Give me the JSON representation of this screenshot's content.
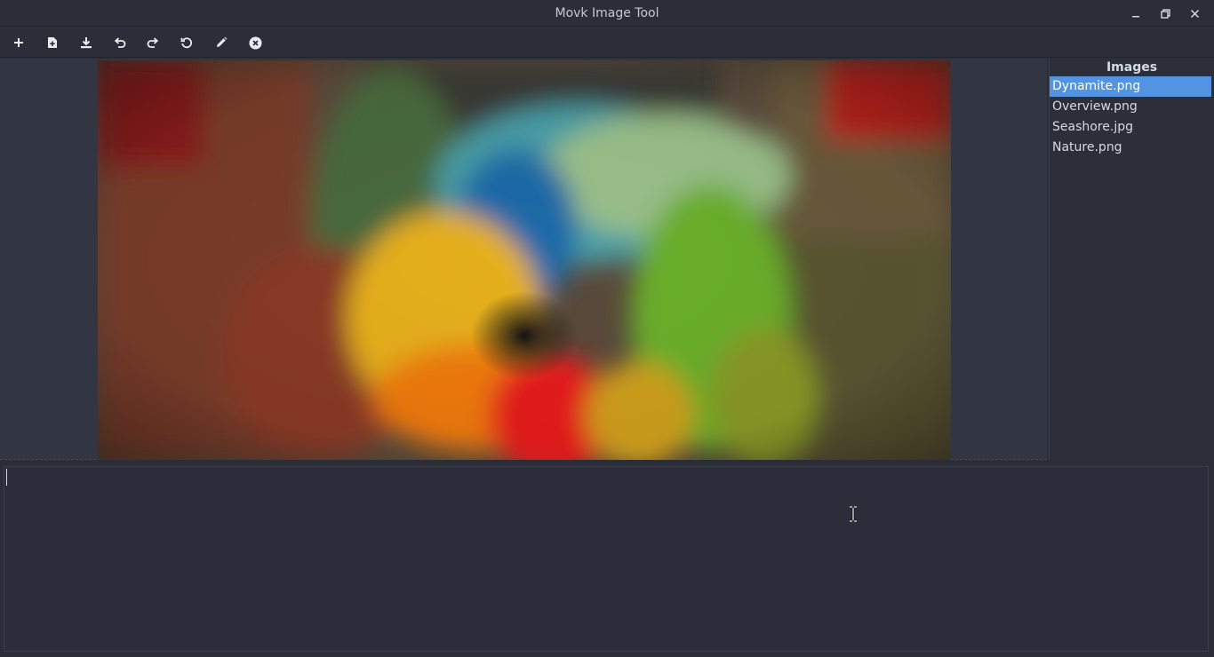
{
  "window": {
    "title": "Movk Image Tool",
    "controls": [
      "minimize-icon",
      "restore-icon",
      "close-icon"
    ]
  },
  "toolbar": {
    "tools": [
      {
        "name": "new",
        "icon": "plus-icon"
      },
      {
        "name": "open-file",
        "icon": "file-plus-icon"
      },
      {
        "name": "download",
        "icon": "download-icon"
      },
      {
        "name": "undo",
        "icon": "undo-icon"
      },
      {
        "name": "redo",
        "icon": "redo-icon"
      },
      {
        "name": "reset",
        "icon": "rotate-ccw-icon"
      },
      {
        "name": "edit",
        "icon": "pencil-icon"
      },
      {
        "name": "close-image",
        "icon": "circle-x-icon"
      }
    ]
  },
  "images_panel": {
    "header": "Images",
    "items": [
      {
        "label": "Dynamite.png",
        "selected": true
      },
      {
        "label": "Overview.png",
        "selected": false
      },
      {
        "label": "Seashore.jpg",
        "selected": false
      },
      {
        "label": "Nature.png",
        "selected": false
      }
    ]
  },
  "editor": {
    "value": ""
  },
  "colors": {
    "accent": "#5294e2",
    "background": "#2b2e39",
    "text": "#d3dae3"
  }
}
